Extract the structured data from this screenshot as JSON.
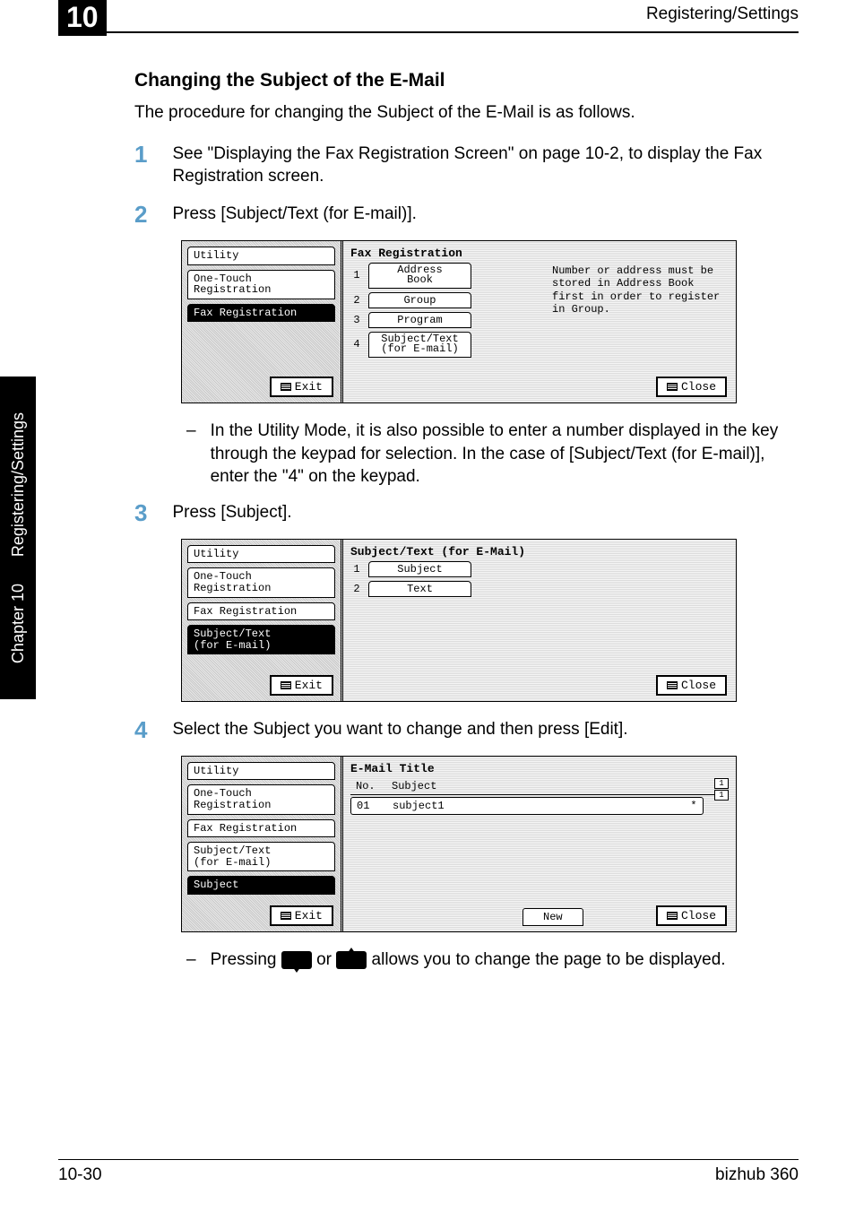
{
  "header": {
    "chapter_number": "10",
    "running_head": "Registering/Settings"
  },
  "side_tab": {
    "line1": "Registering/Settings",
    "line2": "Chapter 10"
  },
  "heading": "Changing the Subject of the E-Mail",
  "intro": "The procedure for changing the Subject of the E-Mail is as follows.",
  "steps": {
    "s1_num": "1",
    "s1_text": "See \"Displaying the Fax Registration Screen\" on page 10-2, to display the Fax Registration screen.",
    "s2_num": "2",
    "s2_text": "Press [Subject/Text (for E-mail)].",
    "s3_num": "3",
    "s3_text": "Press [Subject].",
    "s4_num": "4",
    "s4_text": "Select the Subject you want to change and then press [Edit]."
  },
  "note2": "In the Utility Mode, it is also possible to enter a number displayed in the key through the keypad for selection. In the case of [Subject/Text (for E-mail)], enter the \"4\" on the keypad.",
  "press_note_a": "Pressing ",
  "press_note_b": " or ",
  "press_note_c": " allows you to change the page to be displayed.",
  "screen1": {
    "nav_utility": "Utility",
    "nav_onetouch": "One-Touch\nRegistration",
    "nav_faxreg": "Fax Registration",
    "exit": "Exit",
    "title": "Fax Registration",
    "items": [
      {
        "n": "1",
        "label": "Address\nBook"
      },
      {
        "n": "2",
        "label": "Group"
      },
      {
        "n": "3",
        "label": "Program"
      },
      {
        "n": "4",
        "label": "Subject/Text\n(for E-mail)"
      }
    ],
    "info": "Number or address must be stored in Address Book first in order to register in Group.",
    "close": "Close"
  },
  "screen2": {
    "nav_utility": "Utility",
    "nav_onetouch": "One-Touch\nRegistration",
    "nav_faxreg": "Fax Registration",
    "nav_subj": "Subject/Text\n(for E-mail)",
    "exit": "Exit",
    "title": "Subject/Text (for E-Mail)",
    "items": [
      {
        "n": "1",
        "label": "Subject"
      },
      {
        "n": "2",
        "label": "Text"
      }
    ],
    "close": "Close"
  },
  "screen3": {
    "nav_utility": "Utility",
    "nav_onetouch": "One-Touch\nRegistration",
    "nav_faxreg": "Fax Registration",
    "nav_subj": "Subject/Text\n(for E-mail)",
    "nav_subject": "Subject",
    "exit": "Exit",
    "title": "E-Mail Title",
    "col_no": "No.",
    "col_subject": "Subject",
    "row_no": "01",
    "row_subject": "subject1",
    "star": "*",
    "pager1": "1",
    "pager2": "1",
    "new": "New",
    "close": "Close"
  },
  "footer": {
    "left": "10-30",
    "right": "bizhub 360"
  }
}
